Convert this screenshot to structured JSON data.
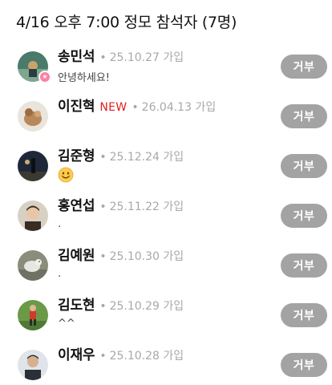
{
  "header": {
    "title": "4/16 오후 7:00 정모 참석자 (7명)"
  },
  "members": [
    {
      "name": "송민석",
      "is_new": false,
      "new_label": "",
      "date": "25.10.27",
      "joined_label": "가입",
      "comment": "안녕하세요!",
      "reject_label": "거부",
      "avatar_colors": [
        "#4a7a6a",
        "#c9a36a"
      ],
      "has_host_badge": true
    },
    {
      "name": "이진혁",
      "is_new": true,
      "new_label": "NEW",
      "date": "26.04.13",
      "joined_label": "가입",
      "comment": "",
      "reject_label": "거부",
      "avatar_colors": [
        "#e9e4dc",
        "#b9885a"
      ],
      "has_host_badge": false
    },
    {
      "name": "김준형",
      "is_new": false,
      "new_label": "",
      "date": "25.12.24",
      "joined_label": "가입",
      "comment": "",
      "comment_icon": "smiling-face-emoji-icon",
      "reject_label": "거부",
      "avatar_colors": [
        "#1e2838",
        "#c8b070"
      ],
      "has_host_badge": false
    },
    {
      "name": "홍연섭",
      "is_new": false,
      "new_label": "",
      "date": "25.11.22",
      "joined_label": "가입",
      "comment": ".",
      "reject_label": "거부",
      "avatar_colors": [
        "#d9d0c4",
        "#3a2c24"
      ],
      "has_host_badge": false
    },
    {
      "name": "김예원",
      "is_new": false,
      "new_label": "",
      "date": "25.10.30",
      "joined_label": "가입",
      "comment": ".",
      "reject_label": "거부",
      "avatar_colors": [
        "#8a8c7c",
        "#e8e6e0"
      ],
      "has_host_badge": false
    },
    {
      "name": "김도현",
      "is_new": false,
      "new_label": "",
      "date": "25.10.29",
      "joined_label": "가입",
      "comment": "^^",
      "reject_label": "거부",
      "avatar_colors": [
        "#6a9a48",
        "#d23a2a"
      ],
      "has_host_badge": false
    },
    {
      "name": "이재우",
      "is_new": false,
      "new_label": "",
      "date": "25.10.28",
      "joined_label": "가입",
      "comment": "",
      "reject_label": "거부",
      "avatar_colors": [
        "#dfe4ea",
        "#2a2f38"
      ],
      "has_host_badge": false
    }
  ],
  "colors": {
    "reject_button": "#a3a3a3",
    "new_badge": "#e02020",
    "meta_text": "#a8a8a8",
    "host_badge": "#ff7fa2"
  }
}
